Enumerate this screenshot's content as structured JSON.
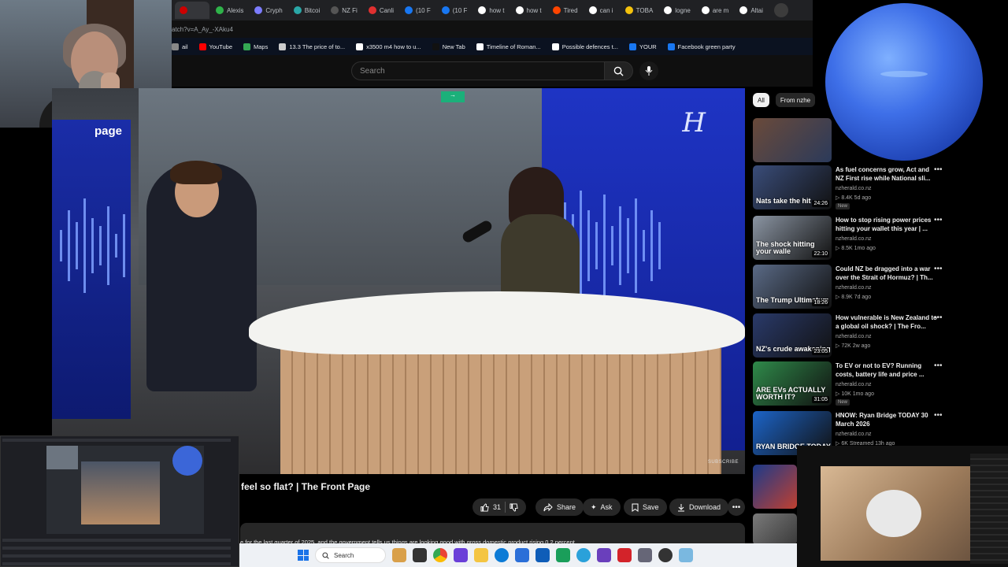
{
  "browser": {
    "tabs": [
      {
        "label": "",
        "color": "#cc0000",
        "active": true
      },
      {
        "label": "Alexis",
        "color": "#2fb34a"
      },
      {
        "label": "Cryph",
        "color": "#7c7cff"
      },
      {
        "label": "Bitcoi",
        "color": "#2aa7a7"
      },
      {
        "label": "NZ Fi",
        "color": "#555555"
      },
      {
        "label": "Canli",
        "color": "#e03030"
      },
      {
        "label": "(10 F",
        "color": "#1877f2"
      },
      {
        "label": "(10 F",
        "color": "#1877f2"
      },
      {
        "label": "how t",
        "color": "#ffffff"
      },
      {
        "label": "how t",
        "color": "#ffffff"
      },
      {
        "label": "Tired",
        "color": "#ff4500"
      },
      {
        "label": "can i",
        "color": "#ffffff"
      },
      {
        "label": "TOBA",
        "color": "#f4c20d"
      },
      {
        "label": "logne",
        "color": "#ffffff"
      },
      {
        "label": "are m",
        "color": "#ffffff"
      },
      {
        "label": "Altai",
        "color": "#ffffff"
      }
    ],
    "url": "atch?v=A_Ay_-XAku4",
    "bookmarks": [
      {
        "label": "ail",
        "color": "#888888"
      },
      {
        "label": "YouTube",
        "color": "#ff0000"
      },
      {
        "label": "Maps",
        "color": "#34a853"
      },
      {
        "label": "13.3 The price of to...",
        "color": "#cccccc"
      },
      {
        "label": "x3500 m4 how to u...",
        "color": "#ffffff"
      },
      {
        "label": "New Tab",
        "color": "#111111"
      },
      {
        "label": "Timeline of Roman...",
        "color": "#ffffff"
      },
      {
        "label": "Possible defences t...",
        "color": "#ffffff"
      },
      {
        "label": "YOUR",
        "color": "#1877f2"
      },
      {
        "label": "Facebook green party",
        "color": "#1877f2"
      }
    ]
  },
  "youtube": {
    "search_placeholder": "Search",
    "video": {
      "watermark": "H",
      "page_logo": "page",
      "subscribe_overlay": "SUBSCRIBE",
      "sign_text": "→"
    },
    "title": "feel so flat? | The Front Page",
    "actions": {
      "likes": "31",
      "share": "Share",
      "ask": "Ask",
      "save": "Save",
      "download": "Download"
    },
    "description": "e for the last quarter of 2025, and the government tells us things are looking good with gross domestic product rising 0.2 percent",
    "chips": [
      "All",
      "From nzhe"
    ],
    "recommendations": [
      {
        "title": "As fuel concerns grow, Act and NZ First rise while National sli...",
        "channel": "nzherald.co.nz",
        "meta": "▷ 8.4K  5d ago",
        "badge": "New",
        "duration": "24:26",
        "caption": "Nats take the hit",
        "thumb": "#3a4d7a"
      },
      {
        "title": "How to stop rising power prices hitting your wallet this year | ...",
        "channel": "nzherald.co.nz",
        "meta": "▷ 8.5K  1mo ago",
        "badge": "",
        "duration": "22:10",
        "caption": "The shock hitting your walle",
        "thumb": "#8b95a3"
      },
      {
        "title": "Could NZ be dragged into a war over the Strait of Hormuz? | Th...",
        "channel": "nzherald.co.nz",
        "meta": "▷ 8.9K  7d ago",
        "badge": "",
        "duration": "18:26",
        "caption": "The Trump Ultimatum",
        "thumb": "#5a6a86"
      },
      {
        "title": "How vulnerable is New Zealand to a global oil shock? | The Fro...",
        "channel": "nzherald.co.nz",
        "meta": "▷ 72K  2w ago",
        "badge": "",
        "duration": "23:05",
        "caption": "NZ's crude awakening",
        "thumb": "#2a3a6a"
      },
      {
        "title": "To EV or not to EV? Running costs, battery life and price ...",
        "channel": "nzherald.co.nz",
        "meta": "▷ 10K  1mo ago",
        "badge": "New",
        "duration": "31:05",
        "caption": "ARE EVs ACTUALLY WORTH IT?",
        "thumb": "#2f8a4a"
      },
      {
        "title": "HNOW: Ryan Bridge TODAY 30 March 2026",
        "channel": "nzherald.co.nz",
        "meta": "▷ 6K  Streamed 13h ago",
        "badge": "",
        "duration": "",
        "caption": "RYAN BRIDGE TODAY",
        "thumb": "#1c64c8"
      }
    ]
  },
  "taskbar": {
    "search": "Search"
  },
  "colors": {
    "accent": "#1a73e8",
    "background": "#0f0f0f"
  }
}
